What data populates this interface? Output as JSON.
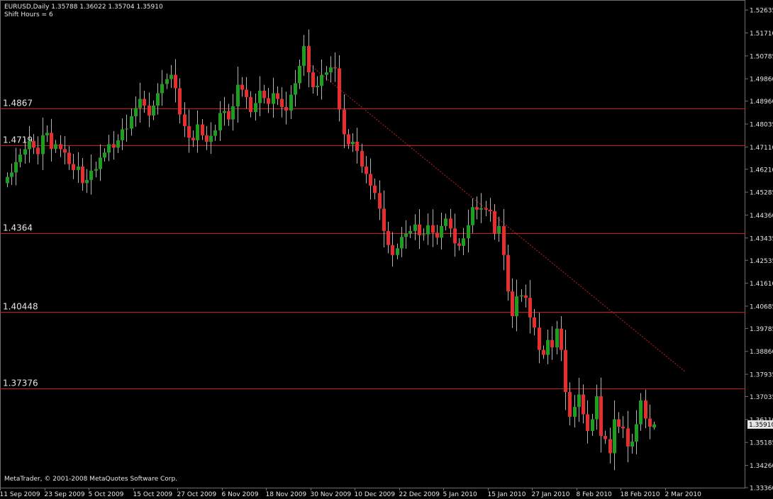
{
  "header": {
    "symbol_line": "EURUSD,Daily  1.35788 1.36022 1.35704 1.35910",
    "shift_line": "Shift Hours = 6"
  },
  "copyright": "MetaTrader, © 2001-2008 MetaQuotes Software Corp.",
  "current_price_label": "1.35910",
  "colors": {
    "background": "#000000",
    "bull_candle": "#1e9e1e",
    "bear_candle": "#e62e2e",
    "wick": "#b4b4b4",
    "level_line": "#c81e1e",
    "trend_line": "#c81e1e",
    "axis_text": "#e6e6e6",
    "price_tag_bg": "#e6e6e6",
    "price_tag_fg": "#000000"
  },
  "chart_data": {
    "type": "candlestick",
    "instrument": "EURUSD",
    "timeframe": "Daily",
    "last_bar": {
      "open": 1.35788,
      "high": 1.36022,
      "low": 1.35704,
      "close": 1.3591
    },
    "y_axis": {
      "ticks": [
        "1.52635",
        "1.51710",
        "1.50785",
        "1.49860",
        "1.48960",
        "1.48035",
        "1.47110",
        "1.46210",
        "1.45285",
        "1.44360",
        "1.43435",
        "1.42535",
        "1.41610",
        "1.40685",
        "1.39785",
        "1.38860",
        "1.37935",
        "1.37035",
        "1.36110",
        "1.35185",
        "1.34260",
        "1.33360"
      ],
      "ylim": [
        1.3336,
        1.52635
      ]
    },
    "x_axis": {
      "tick_labels": [
        "11 Sep 2009",
        "23 Sep 2009",
        "5 Oct 2009",
        "15 Oct 2009",
        "27 Oct 2009",
        "6 Nov 2009",
        "18 Nov 2009",
        "30 Nov 2009",
        "10 Dec 2009",
        "22 Dec 2009",
        "5 Jan 2010",
        "15 Jan 2010",
        "27 Jan 2010",
        "8 Feb 2010",
        "18 Feb 2010",
        "2 Mar 2010"
      ],
      "bars_between_ticks": 10
    },
    "horizontal_levels": [
      {
        "label": "1.4867",
        "value": 1.4867
      },
      {
        "label": "1.4719",
        "value": 1.4719
      },
      {
        "label": "1.4364",
        "value": 1.4364
      },
      {
        "label": "1.40448",
        "value": 1.40448
      },
      {
        "label": "1.37376",
        "value": 1.37376
      }
    ],
    "trend_line": {
      "from_bar": 68,
      "from_price": 1.5048,
      "to_bar": 153,
      "to_price": 1.3805,
      "style": "dotted"
    },
    "closes": [
      1.459,
      1.4608,
      1.465,
      1.468,
      1.4702,
      1.4735,
      1.4708,
      1.4682,
      1.4758,
      1.4768,
      1.4703,
      1.4722,
      1.4702,
      1.4688,
      1.4642,
      1.4618,
      1.4632,
      1.4565,
      1.4578,
      1.4615,
      1.4622,
      1.4668,
      1.4688,
      1.4722,
      1.4708,
      1.4738,
      1.4782,
      1.4785,
      1.4835,
      1.4868,
      1.4905,
      1.4878,
      1.4838,
      1.4878,
      1.4928,
      1.4965,
      1.4985,
      1.5002,
      1.4948,
      1.4842,
      1.4795,
      1.4748,
      1.4738,
      1.4802,
      1.4758,
      1.4732,
      1.4756,
      1.4778,
      1.4848,
      1.4856,
      1.4822,
      1.4875,
      1.4962,
      1.4942,
      1.4912,
      1.4852,
      1.4888,
      1.4938,
      1.4908,
      1.4885,
      1.4928,
      1.4905,
      1.4872,
      1.4858,
      1.4922,
      1.4968,
      1.5038,
      1.5118,
      1.5012,
      1.4952,
      1.4958,
      1.5002,
      1.5012,
      1.5032,
      1.5028,
      1.4862,
      1.4762,
      1.4722,
      1.4732,
      1.4695,
      1.4632,
      1.4602,
      1.4555,
      1.4525,
      1.4462,
      1.4372,
      1.4315,
      1.4275,
      1.4302,
      1.4348,
      1.4362,
      1.4372,
      1.4398,
      1.4355,
      1.4358,
      1.4395,
      1.4365,
      1.4345,
      1.4392,
      1.4422,
      1.4382,
      1.4322,
      1.4312,
      1.4342,
      1.4395,
      1.4468,
      1.4458,
      1.4464,
      1.4458,
      1.4452,
      1.4362,
      1.4392,
      1.4275,
      1.4128,
      1.4028,
      1.4108,
      1.4112,
      1.4102,
      1.4023,
      1.3982,
      1.3892,
      1.3872,
      1.3932,
      1.3902,
      1.3978,
      1.3892,
      1.3722,
      1.3622,
      1.3662,
      1.3712,
      1.3632,
      1.3565,
      1.3612,
      1.3705,
      1.3545,
      1.3532,
      1.3475,
      1.3612,
      1.3582,
      1.3575,
      1.3502,
      1.3522,
      1.3592,
      1.3688,
      1.3615,
      1.3582,
      1.3591
    ]
  }
}
